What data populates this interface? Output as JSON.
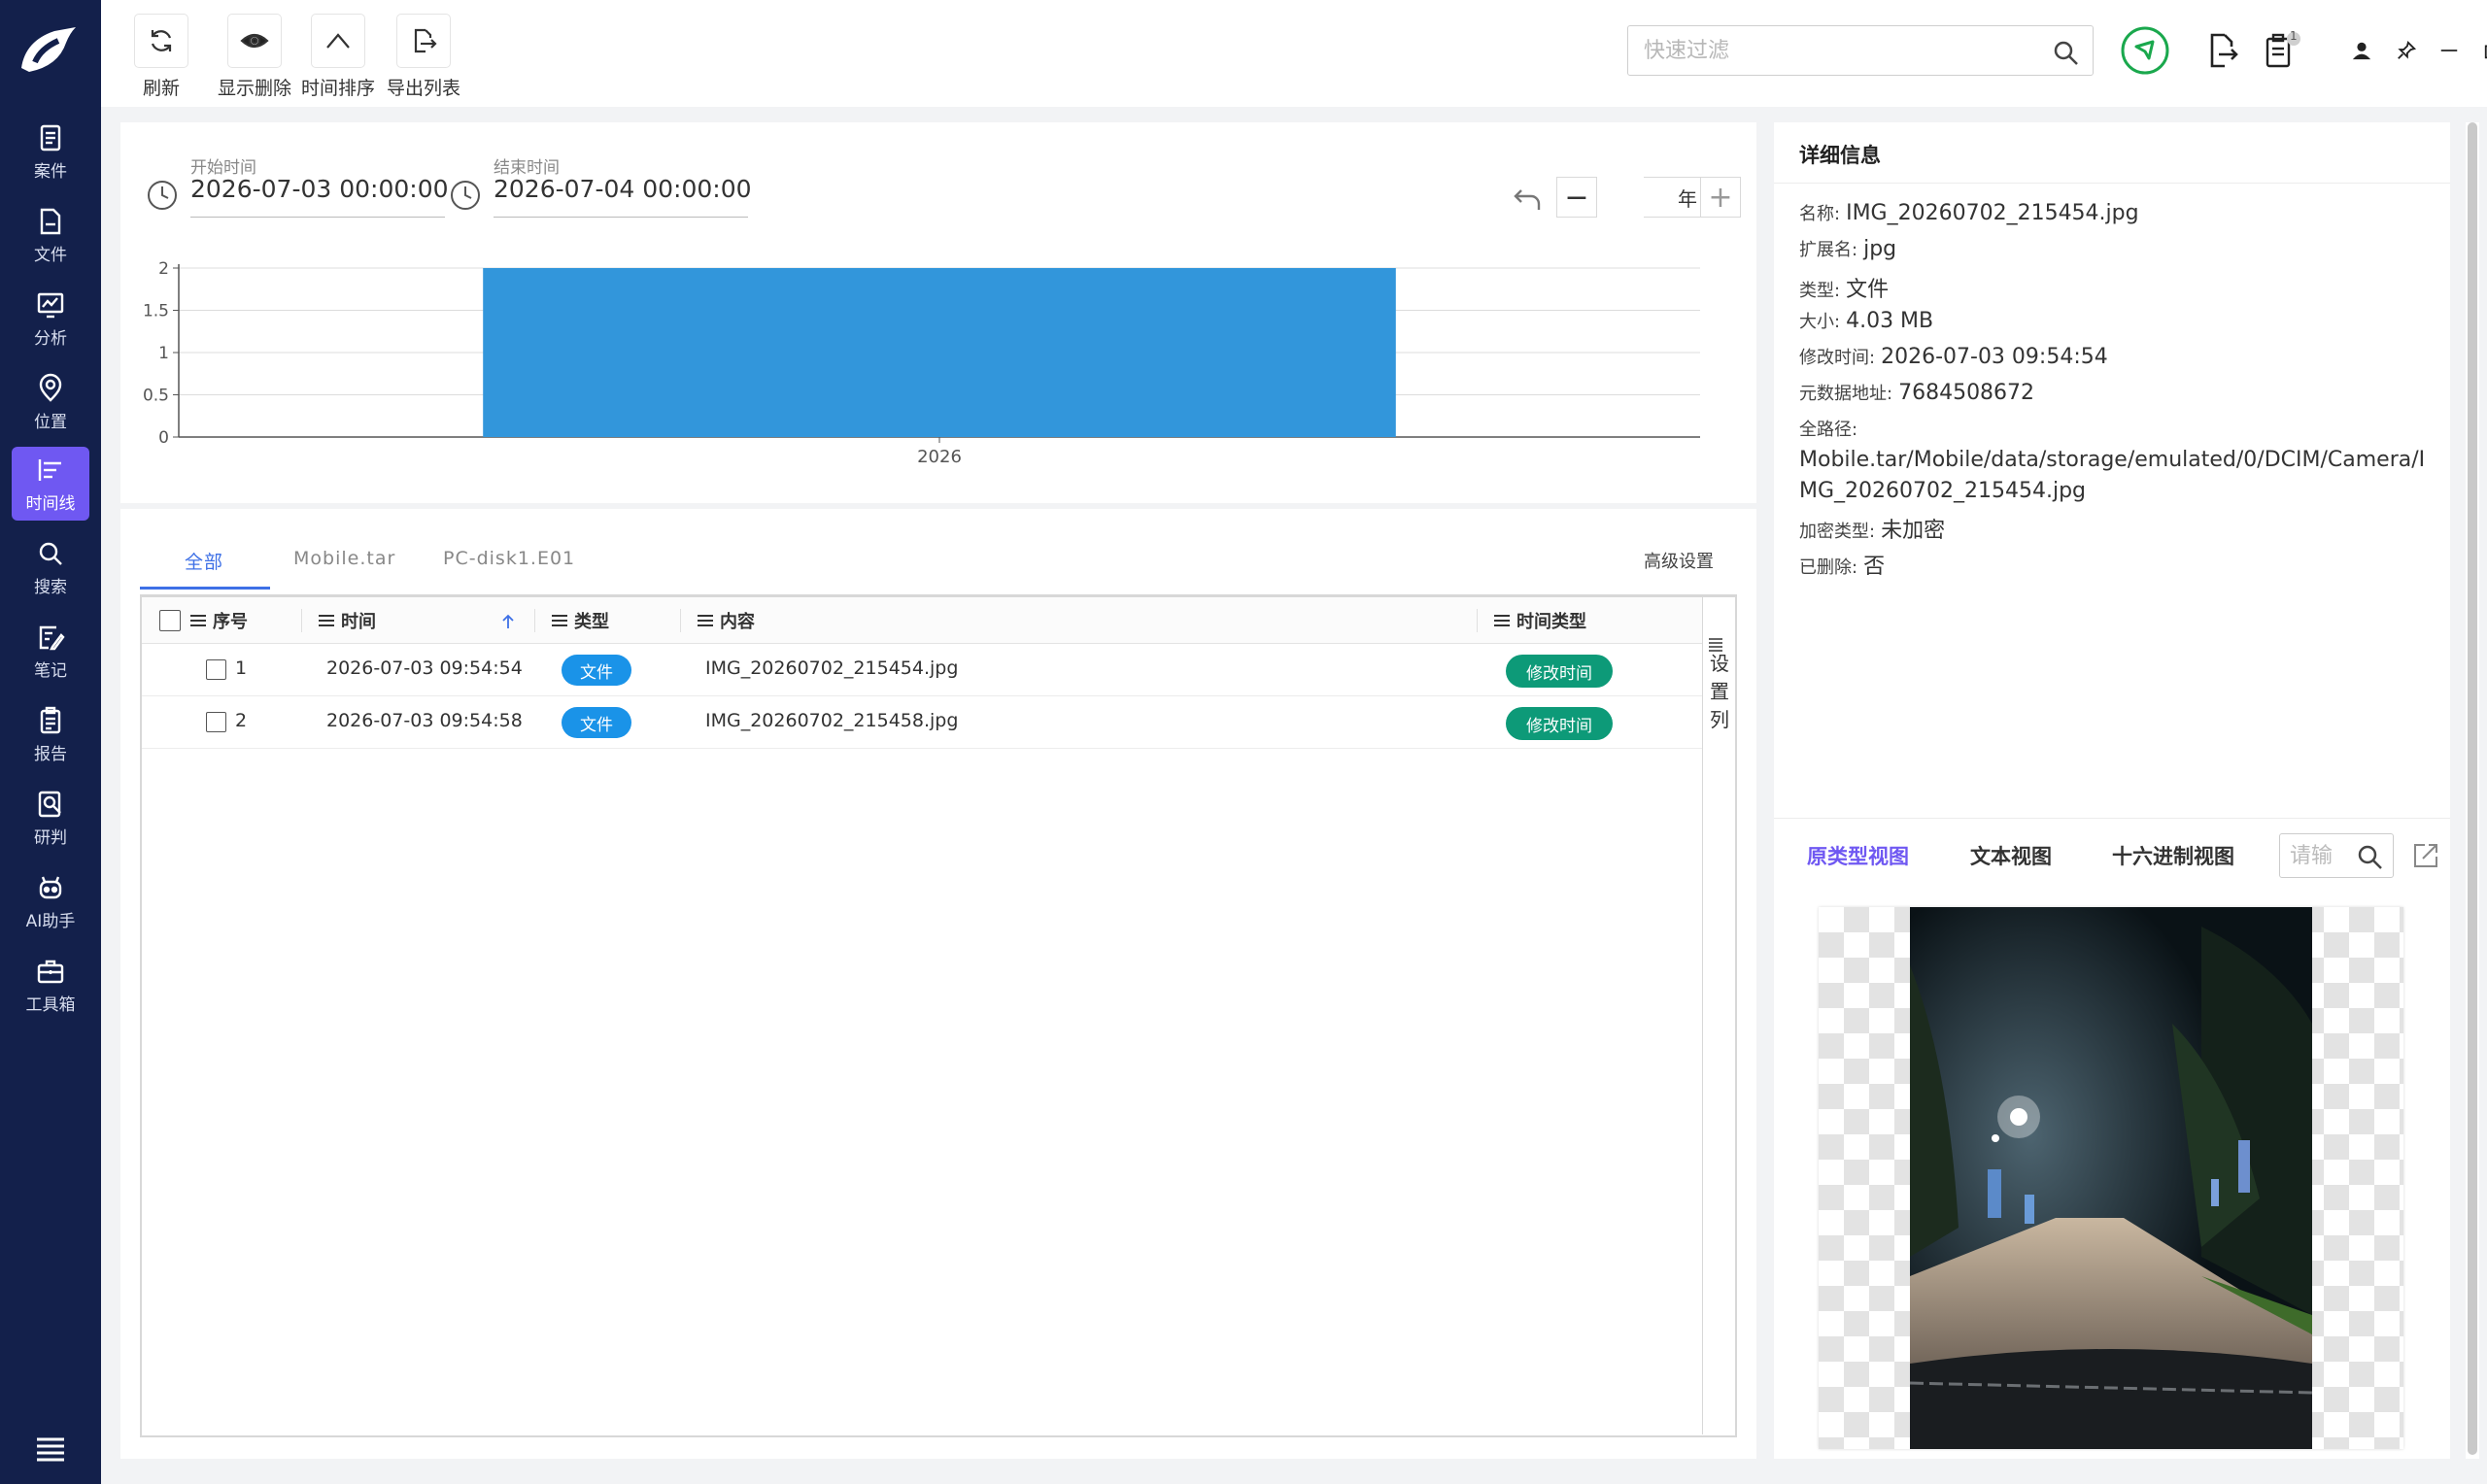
{
  "sidebar": {
    "items": [
      {
        "label": "案件",
        "icon": "case-icon"
      },
      {
        "label": "文件",
        "icon": "folder-icon"
      },
      {
        "label": "分析",
        "icon": "analysis-icon"
      },
      {
        "label": "位置",
        "icon": "location-icon"
      },
      {
        "label": "时间线",
        "icon": "timeline-icon",
        "active": true
      },
      {
        "label": "搜索",
        "icon": "search-icon"
      },
      {
        "label": "笔记",
        "icon": "note-icon"
      },
      {
        "label": "报告",
        "icon": "report-icon"
      },
      {
        "label": "研判",
        "icon": "judge-icon"
      },
      {
        "label": "AI助手",
        "icon": "robot-icon"
      },
      {
        "label": "工具箱",
        "icon": "toolbox-icon"
      }
    ]
  },
  "toolbar": {
    "refresh_label": "刷新",
    "show_deleted_label": "显示删除",
    "time_sort_label": "时间排序",
    "export_list_label": "导出列表",
    "search_placeholder": "快速过滤",
    "badge_count": "1",
    "accent_color": "#6f58f2"
  },
  "range": {
    "start_label": "开始时间",
    "start_value": "2026-07-03 00:00:00",
    "end_label": "结束时间",
    "end_value": "2026-07-04 00:00:00",
    "zoom_unit": "年",
    "zoom_minus": "−",
    "zoom_plus": "+"
  },
  "chart_data": {
    "type": "bar",
    "categories": [
      "2026"
    ],
    "values": [
      2
    ],
    "ylim": [
      0,
      2
    ],
    "yticks": [
      "0",
      "0.5",
      "1",
      "1.5",
      "2"
    ],
    "grid": true,
    "bar_color": "#3296db"
  },
  "tabs": [
    {
      "label": "全部",
      "active": true
    },
    {
      "label": "Mobile.tar"
    },
    {
      "label": "PC-disk1.E01"
    }
  ],
  "advanced_settings": "高级设置",
  "table": {
    "columns": [
      "序号",
      "时间",
      "类型",
      "内容",
      "时间类型"
    ],
    "rows": [
      {
        "index": "1",
        "time": "2026-07-03 09:54:54",
        "type": "文件",
        "content": "IMG_20260702_215454.jpg",
        "time_type": "修改时间"
      },
      {
        "index": "2",
        "time": "2026-07-03 09:54:58",
        "type": "文件",
        "content": "IMG_20260702_215458.jpg",
        "time_type": "修改时间"
      }
    ],
    "set_columns": "设置列",
    "type_color": "#1a93e8",
    "time_type_color": "#0d9a78"
  },
  "detail": {
    "title": "详细信息",
    "name_k": "名称:",
    "name_v": "IMG_20260702_215454.jpg",
    "ext_k": "扩展名:",
    "ext_v": "jpg",
    "type_k": "类型:",
    "type_v": "文件",
    "size_k": "大小:",
    "size_v": "4.03 MB",
    "mtime_k": "修改时间:",
    "mtime_v": "2026-07-03 09:54:54",
    "meta_k": "元数据地址:",
    "meta_v": "7684508672",
    "path_k": "全路径:",
    "path_v": "Mobile.tar/Mobile/data/storage/emulated/0/DCIM/Camera/IMG_20260702_215454.jpg",
    "enc_k": "加密类型:",
    "enc_v": "未加密",
    "del_k": "已删除:",
    "del_v": "否",
    "view_tabs": [
      "原类型视图",
      "文本视图",
      "十六进制视图"
    ],
    "view_search_placeholder": "请输"
  }
}
